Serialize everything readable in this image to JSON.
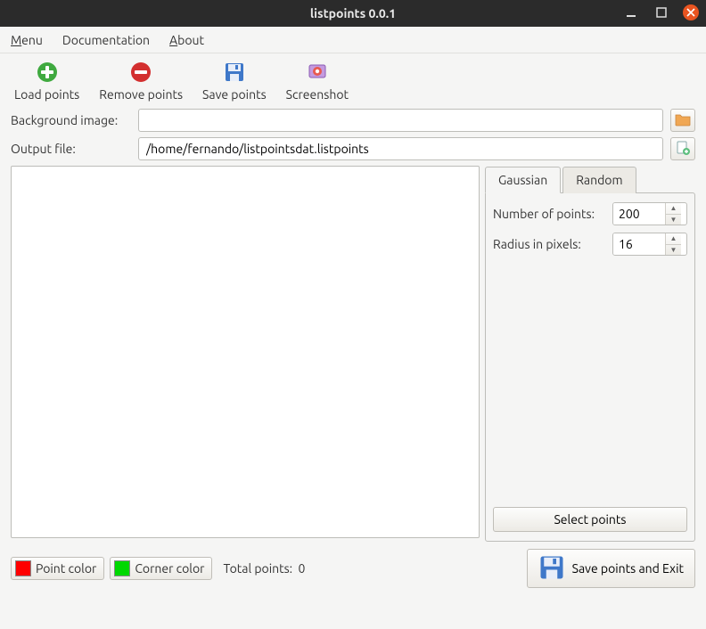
{
  "window": {
    "title": "listpoints 0.0.1"
  },
  "menubar": {
    "menu": "Menu",
    "documentation": "Documentation",
    "about": "About"
  },
  "toolbar": {
    "load": "Load points",
    "remove": "Remove points",
    "save": "Save points",
    "screenshot": "Screenshot"
  },
  "form": {
    "bg_label": "Background image:",
    "bg_value": "",
    "out_label": "Output file:",
    "out_value": "/home/fernando/listpointsdat.listpoints"
  },
  "tabs": {
    "gaussian": "Gaussian",
    "random": "Random"
  },
  "params": {
    "npoints_label": "Number of points:",
    "npoints_value": "200",
    "radius_label": "Radius in pixels:",
    "radius_value": "16",
    "select_label": "Select points"
  },
  "bottom": {
    "point_color_label": "Point color",
    "corner_color_label": "Corner color",
    "total_label": "Total points:",
    "total_value": "0",
    "save_exit": "Save points and Exit"
  },
  "colors": {
    "point": "#ff0000",
    "corner": "#00d800",
    "accent_add": "#3fa93f",
    "accent_remove": "#d32f2f",
    "accent_close": "#e95420",
    "folder": "#f0a753",
    "save_blue": "#3f78c9"
  }
}
